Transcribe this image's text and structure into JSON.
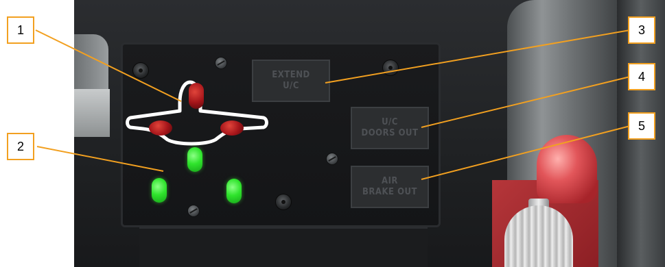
{
  "warning_lights": {
    "extend_uc": {
      "line1": "EXTEND",
      "line2": "U/C"
    },
    "uc_doors_out": {
      "line1": "U/C",
      "line2": "DOORS OUT"
    },
    "air_brake_out": {
      "line1": "AIR",
      "line2": "BRAKE OUT"
    }
  },
  "landing_gear_indicator": {
    "red_lights": [
      "nose",
      "left",
      "right"
    ],
    "green_lights": [
      "nose",
      "left",
      "right"
    ]
  },
  "callouts": [
    "1",
    "2",
    "3",
    "4",
    "5"
  ],
  "colors": {
    "callout_border": "#f2a020",
    "leader_line": "#f2a020",
    "red_light": "#c0181e",
    "green_light": "#2fe42c",
    "panel": "#1a1b1d",
    "handle": "#b6363a"
  }
}
